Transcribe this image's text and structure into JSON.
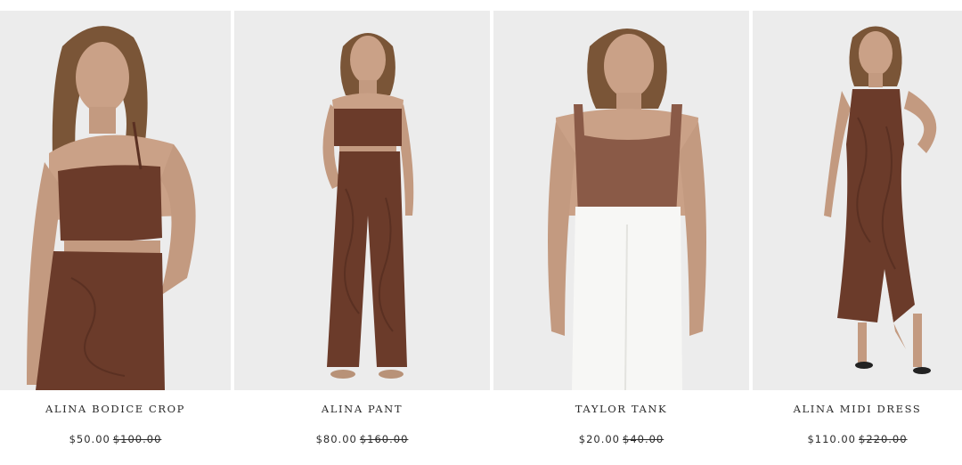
{
  "products": [
    {
      "name": "ALINA BODICE CROP",
      "price": "$50.00",
      "was_price": "$100.00"
    },
    {
      "name": "ALINA PANT",
      "price": "$80.00",
      "was_price": "$160.00"
    },
    {
      "name": "TAYLOR TANK",
      "price": "$20.00",
      "was_price": "$40.00"
    },
    {
      "name": "ALINA MIDI DRESS",
      "price": "$110.00",
      "was_price": "$220.00"
    }
  ],
  "colors": {
    "backdrop": "#ececec",
    "garment_brown": "#6b3b2a",
    "skin": "#caa187",
    "hair": "#7a5537",
    "white_pant": "#f7f7f5",
    "text": "#2a2a2a"
  }
}
